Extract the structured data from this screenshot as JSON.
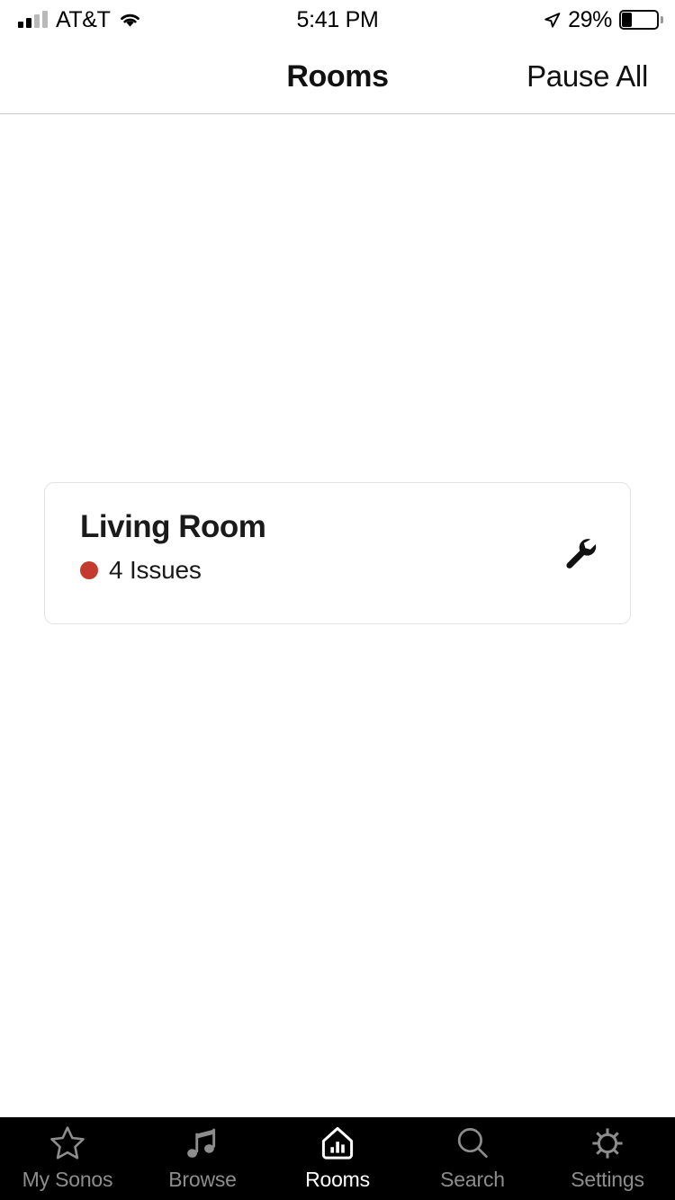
{
  "status_bar": {
    "carrier": "AT&T",
    "signal_bars_total": 4,
    "signal_bars_filled": 2,
    "wifi_icon": "wifi-icon",
    "time": "5:41 PM",
    "location_icon": "location-arrow-icon",
    "battery_percent": "29%",
    "battery_level": 29
  },
  "nav_bar": {
    "title": "Rooms",
    "action_label": "Pause All"
  },
  "main": {
    "rooms": [
      {
        "name": "Living Room",
        "status_text": "4 Issues",
        "status_dot_color": "#c53a2e",
        "action_icon": "wrench-icon"
      }
    ]
  },
  "tab_bar": {
    "active_index": 2,
    "items": [
      {
        "label": "My Sonos",
        "icon": "star-icon"
      },
      {
        "label": "Browse",
        "icon": "music-note-icon"
      },
      {
        "label": "Rooms",
        "icon": "house-bars-icon"
      },
      {
        "label": "Search",
        "icon": "search-icon"
      },
      {
        "label": "Settings",
        "icon": "gear-icon"
      }
    ]
  },
  "colors": {
    "accent_red": "#c53a2e",
    "tab_active": "#ffffff",
    "tab_inactive": "#8d8d8d",
    "tab_background": "#000000",
    "card_border": "#e2e2e4",
    "nav_separator": "#c8c8ca"
  }
}
